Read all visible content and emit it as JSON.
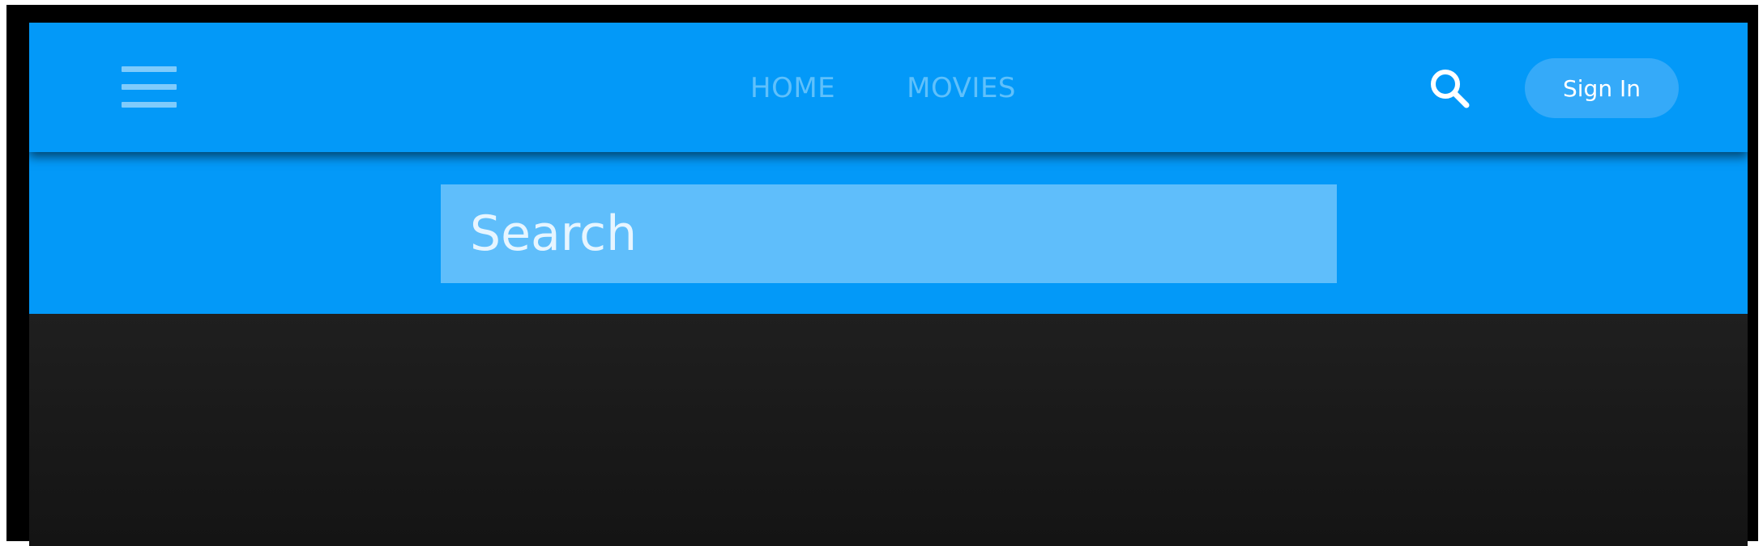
{
  "colors": {
    "primary": "#0399f8",
    "search_field": "#5fbefb",
    "sign_in_bg": "#35aaf9",
    "nav_link": "#5fc0fb",
    "content_bg": "#1e1e1e"
  },
  "navbar": {
    "menu_icon": "hamburger-menu-icon",
    "links": [
      {
        "label": "HOME"
      },
      {
        "label": "MOVIES"
      }
    ],
    "search_icon": "search-icon",
    "sign_in_label": "Sign In"
  },
  "search": {
    "placeholder": "Search"
  }
}
